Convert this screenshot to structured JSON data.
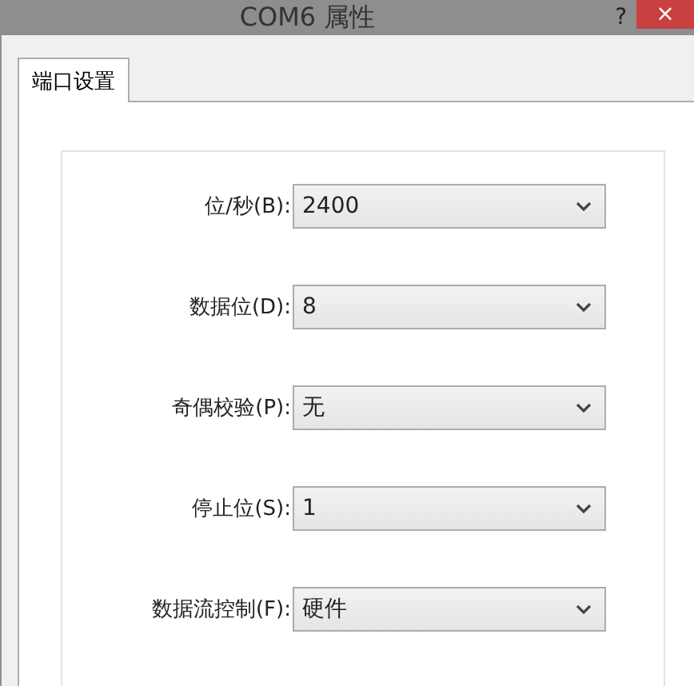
{
  "window": {
    "title": "COM6 属性",
    "help": "?",
    "close": "×"
  },
  "tabs": [
    {
      "label": "端口设置",
      "selected": true
    }
  ],
  "fields": [
    {
      "label": "位/秒(B):",
      "value": "2400"
    },
    {
      "label": "数据位(D):",
      "value": "8"
    },
    {
      "label": "奇偶校验(P):",
      "value": "无"
    },
    {
      "label": "停止位(S):",
      "value": "1"
    },
    {
      "label": "数据流控制(F):",
      "value": "硬件"
    }
  ]
}
